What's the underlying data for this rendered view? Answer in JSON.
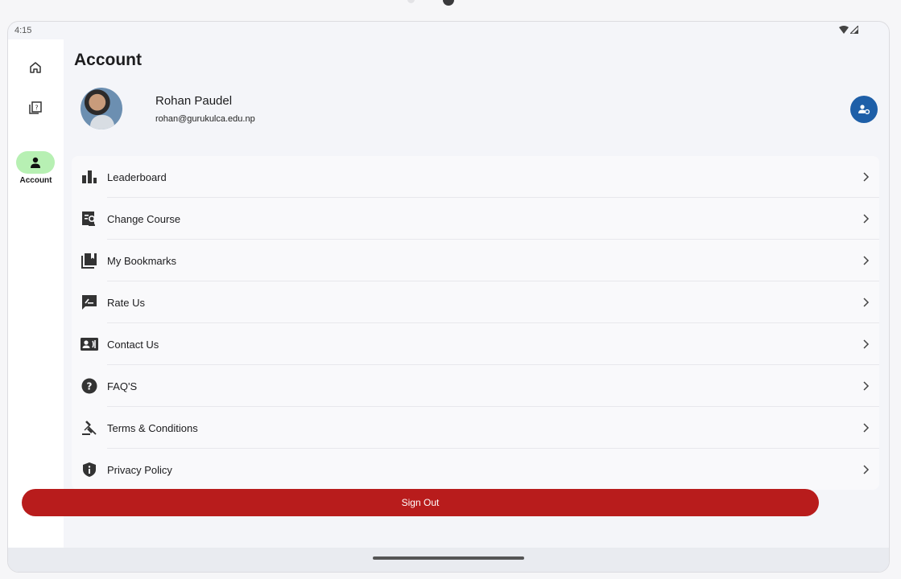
{
  "status_bar": {
    "time": "4:15"
  },
  "nav_rail": {
    "items": [
      {
        "icon": "home-icon",
        "label": ""
      },
      {
        "icon": "quiz-book-icon",
        "label": ""
      },
      {
        "icon": "person-icon",
        "label": "Account",
        "active": true
      }
    ]
  },
  "page": {
    "title": "Account"
  },
  "profile": {
    "name": "Rohan Paudel",
    "email": "rohan@gurukulca.edu.np",
    "action_icon": "manage-account-icon"
  },
  "menu": [
    {
      "label": "Leaderboard",
      "icon": "bar-chart-icon"
    },
    {
      "label": "Change Course",
      "icon": "course-search-icon"
    },
    {
      "label": "My Bookmarks",
      "icon": "bookmarks-icon"
    },
    {
      "label": "Rate Us",
      "icon": "rate-icon"
    },
    {
      "label": "Contact Us",
      "icon": "contact-card-icon"
    },
    {
      "label": "FAQ'S",
      "icon": "help-circle-icon"
    },
    {
      "label": "Terms & Conditions",
      "icon": "gavel-icon"
    },
    {
      "label": "Privacy Policy",
      "icon": "shield-icon"
    }
  ],
  "signout": {
    "label": "Sign Out"
  },
  "colors": {
    "accent_green": "#b7f0b3",
    "primary_blue": "#1e5fa8",
    "signout_red": "#b81c1c"
  }
}
